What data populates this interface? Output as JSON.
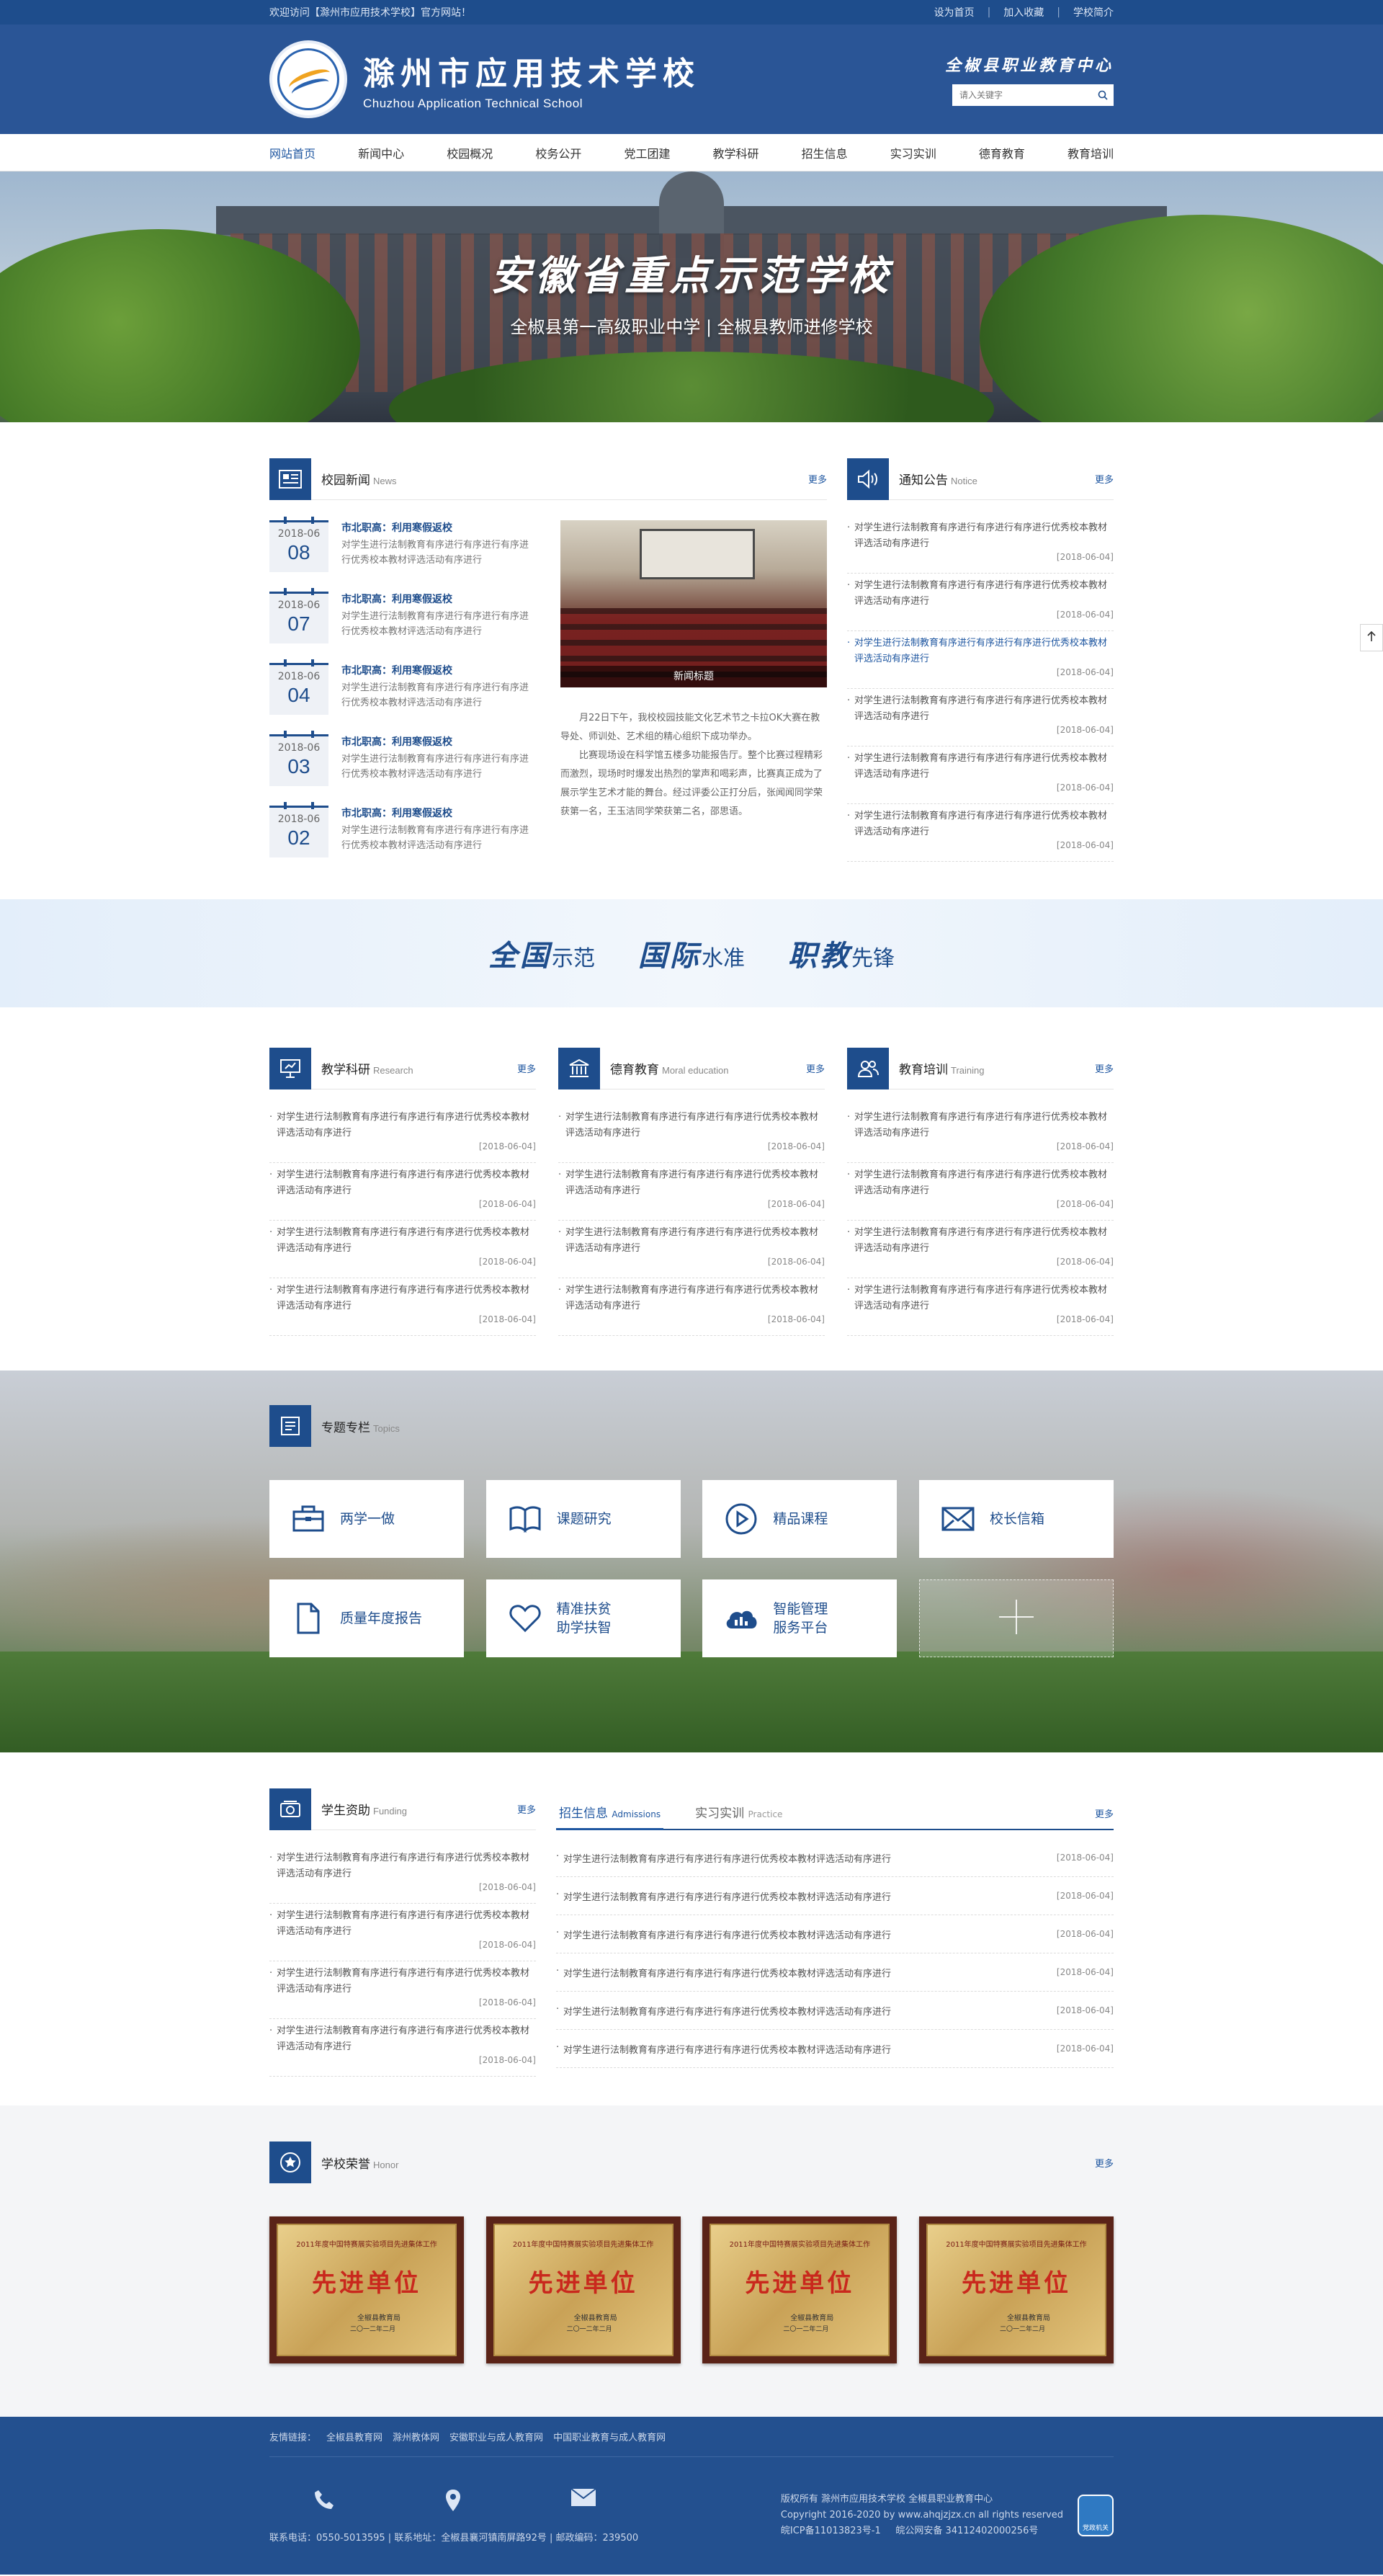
{
  "topbar": {
    "welcome": "欢迎访问【滁州市应用技术学校】官方网站！",
    "links": [
      "设为首页",
      "加入收藏",
      "学校简介"
    ]
  },
  "header": {
    "name_cn": "滁州市应用技术学校",
    "name_en": "Chuzhou Application Technical School",
    "slogan": "全椒县职业教育中心",
    "search_placeholder": "请入关键字"
  },
  "nav": [
    "网站首页",
    "新闻中心",
    "校园概况",
    "校务公开",
    "党工团建",
    "教学科研",
    "招生信息",
    "实习实训",
    "德育教育",
    "教育培训"
  ],
  "banner": {
    "title": "安徽省重点示范学校",
    "subtitle": "全椒县第一高级职业中学 | 全椒县教师进修学校"
  },
  "news": {
    "title": "校园新闻",
    "title_en": "News",
    "more": "更多",
    "items": [
      {
        "ym": "2018-06",
        "day": "08",
        "title": "市北职高：利用寒假返校",
        "desc": "对学生进行法制教育有序进行有序进行有序进行优秀校本教材评选活动有序进行"
      },
      {
        "ym": "2018-06",
        "day": "07",
        "title": "市北职高：利用寒假返校",
        "desc": "对学生进行法制教育有序进行有序进行有序进行优秀校本教材评选活动有序进行"
      },
      {
        "ym": "2018-06",
        "day": "04",
        "title": "市北职高：利用寒假返校",
        "desc": "对学生进行法制教育有序进行有序进行有序进行优秀校本教材评选活动有序进行"
      },
      {
        "ym": "2018-06",
        "day": "03",
        "title": "市北职高：利用寒假返校",
        "desc": "对学生进行法制教育有序进行有序进行有序进行优秀校本教材评选活动有序进行"
      },
      {
        "ym": "2018-06",
        "day": "02",
        "title": "市北职高：利用寒假返校",
        "desc": "对学生进行法制教育有序进行有序进行有序进行优秀校本教材评选活动有序进行"
      }
    ],
    "feature_caption": "新闻标题",
    "feature_p1": "月22日下午，我校校园技能文化艺术节之卡拉OK大赛在教导处、师训处、艺术组的精心组织下成功举办。",
    "feature_p2": "比赛现场设在科学馆五楼多功能报告厅。整个比赛过程精彩而激烈，现场时时爆发出热烈的掌声和喝彩声，比赛真正成为了展示学生艺术才能的舞台。经过评委公正打分后，张闻闻同学荣获第一名，王玉洁同学荣获第二名，邵思语。"
  },
  "notice": {
    "title": "通知公告",
    "title_en": "Notice",
    "more": "更多",
    "items": [
      {
        "text": "对学生进行法制教育有序进行有序进行有序进行优秀校本教材评选活动有序进行",
        "date": "[2018-06-04]"
      },
      {
        "text": "对学生进行法制教育有序进行有序进行有序进行优秀校本教材评选活动有序进行",
        "date": "[2018-06-04]"
      },
      {
        "text": "对学生进行法制教育有序进行有序进行有序进行优秀校本教材评选活动有序进行",
        "date": "[2018-06-04]"
      },
      {
        "text": "对学生进行法制教育有序进行有序进行有序进行优秀校本教材评选活动有序进行",
        "date": "[2018-06-04]"
      },
      {
        "text": "对学生进行法制教育有序进行有序进行有序进行优秀校本教材评选活动有序进行",
        "date": "[2018-06-04]"
      },
      {
        "text": "对学生进行法制教育有序进行有序进行有序进行优秀校本教材评选活动有序进行",
        "date": "[2018-06-04]"
      }
    ]
  },
  "slogans": [
    {
      "big": "全国",
      "small": "示范"
    },
    {
      "big": "国际",
      "small": "水准"
    },
    {
      "big": "职教",
      "small": "先锋"
    }
  ],
  "columns": [
    {
      "title": "教学科研",
      "title_en": "Research",
      "more": "更多",
      "items": [
        {
          "text": "对学生进行法制教育有序进行有序进行有序进行优秀校本教材评选活动有序进行",
          "date": "[2018-06-04]"
        },
        {
          "text": "对学生进行法制教育有序进行有序进行有序进行优秀校本教材评选活动有序进行",
          "date": "[2018-06-04]"
        },
        {
          "text": "对学生进行法制教育有序进行有序进行有序进行优秀校本教材评选活动有序进行",
          "date": "[2018-06-04]"
        },
        {
          "text": "对学生进行法制教育有序进行有序进行有序进行优秀校本教材评选活动有序进行",
          "date": "[2018-06-04]"
        }
      ]
    },
    {
      "title": "德育教育",
      "title_en": "Moral education",
      "more": "更多",
      "items": [
        {
          "text": "对学生进行法制教育有序进行有序进行有序进行优秀校本教材评选活动有序进行",
          "date": "[2018-06-04]"
        },
        {
          "text": "对学生进行法制教育有序进行有序进行有序进行优秀校本教材评选活动有序进行",
          "date": "[2018-06-04]"
        },
        {
          "text": "对学生进行法制教育有序进行有序进行有序进行优秀校本教材评选活动有序进行",
          "date": "[2018-06-04]"
        },
        {
          "text": "对学生进行法制教育有序进行有序进行有序进行优秀校本教材评选活动有序进行",
          "date": "[2018-06-04]"
        }
      ]
    },
    {
      "title": "教育培训",
      "title_en": "Training",
      "more": "更多",
      "items": [
        {
          "text": "对学生进行法制教育有序进行有序进行有序进行优秀校本教材评选活动有序进行",
          "date": "[2018-06-04]"
        },
        {
          "text": "对学生进行法制教育有序进行有序进行有序进行优秀校本教材评选活动有序进行",
          "date": "[2018-06-04]"
        },
        {
          "text": "对学生进行法制教育有序进行有序进行有序进行优秀校本教材评选活动有序进行",
          "date": "[2018-06-04]"
        },
        {
          "text": "对学生进行法制教育有序进行有序进行有序进行优秀校本教材评选活动有序进行",
          "date": "[2018-06-04]"
        }
      ]
    }
  ],
  "topics": {
    "title": "专题专栏",
    "title_en": "Topics",
    "cards": [
      {
        "label": "两学一做",
        "icon": "briefcase-icon"
      },
      {
        "label": "课题研究",
        "icon": "book-icon"
      },
      {
        "label": "精品课程",
        "icon": "play-icon"
      },
      {
        "label": "校长信箱",
        "icon": "mail-icon"
      },
      {
        "label": "质量年度报告",
        "icon": "document-icon"
      },
      {
        "label": "精准扶贫\n助学扶智",
        "icon": "heart-icon"
      },
      {
        "label": "智能管理\n服务平台",
        "icon": "cloud-chart-icon"
      }
    ]
  },
  "funding": {
    "title": "学生资助",
    "title_en": "Funding",
    "more": "更多",
    "items": [
      {
        "text": "对学生进行法制教育有序进行有序进行有序进行优秀校本教材评选活动有序进行",
        "date": "[2018-06-04]"
      },
      {
        "text": "对学生进行法制教育有序进行有序进行有序进行优秀校本教材评选活动有序进行",
        "date": "[2018-06-04]"
      },
      {
        "text": "对学生进行法制教育有序进行有序进行有序进行优秀校本教材评选活动有序进行",
        "date": "[2018-06-04]"
      },
      {
        "text": "对学生进行法制教育有序进行有序进行有序进行优秀校本教材评选活动有序进行",
        "date": "[2018-06-04]"
      }
    ]
  },
  "admissions": {
    "tabs": [
      {
        "label": "招生信息",
        "en": "Admissions"
      },
      {
        "label": "实习实训",
        "en": "Practice"
      }
    ],
    "more": "更多",
    "items": [
      {
        "text": "对学生进行法制教育有序进行有序进行有序进行优秀校本教材评选活动有序进行",
        "date": "[2018-06-04]"
      },
      {
        "text": "对学生进行法制教育有序进行有序进行有序进行优秀校本教材评选活动有序进行",
        "date": "[2018-06-04]"
      },
      {
        "text": "对学生进行法制教育有序进行有序进行有序进行优秀校本教材评选活动有序进行",
        "date": "[2018-06-04]"
      },
      {
        "text": "对学生进行法制教育有序进行有序进行有序进行优秀校本教材评选活动有序进行",
        "date": "[2018-06-04]"
      },
      {
        "text": "对学生进行法制教育有序进行有序进行有序进行优秀校本教材评选活动有序进行",
        "date": "[2018-06-04]"
      },
      {
        "text": "对学生进行法制教育有序进行有序进行有序进行优秀校本教材评选活动有序进行",
        "date": "[2018-06-04]"
      }
    ]
  },
  "honor": {
    "title": "学校荣誉",
    "title_en": "Honor",
    "more": "更多",
    "plaques": [
      {
        "top": "2011年度中国特赛展实验项目先进集体工作",
        "main": "先进单位",
        "org": "全椒县教育局",
        "date": "二〇一二年二月"
      },
      {
        "top": "2011年度中国特赛展实验项目先进集体工作",
        "main": "先进单位",
        "org": "全椒县教育局",
        "date": "二〇一二年二月"
      },
      {
        "top": "2011年度中国特赛展实验项目先进集体工作",
        "main": "先进单位",
        "org": "全椒县教育局",
        "date": "二〇一二年二月"
      },
      {
        "top": "2011年度中国特赛展实验项目先进集体工作",
        "main": "先进单位",
        "org": "全椒县教育局",
        "date": "二〇一二年二月"
      }
    ]
  },
  "footer": {
    "links_label": "友情链接：",
    "links": [
      "全椒县教育网",
      "滁州教体网",
      "安徽职业与成人教育网",
      "中国职业教育与成人教育网"
    ],
    "contact": "联系电话：0550-5013595 | 联系地址：全椒县襄河镇南屏路92号 | 邮政编码：239500",
    "copy1": "版权所有 滁州市应用技术学校 全椒县职业教育中心",
    "copy2": "Copyright 2016-2020 by www.ahqjzjzx.cn all rights reserved",
    "copy3": "皖ICP备11013823号-1     皖公网安备 34112402000256号",
    "badge": "党政机关"
  },
  "colors": {
    "primary": "#1e4d8c",
    "accent": "#1e56a0"
  }
}
